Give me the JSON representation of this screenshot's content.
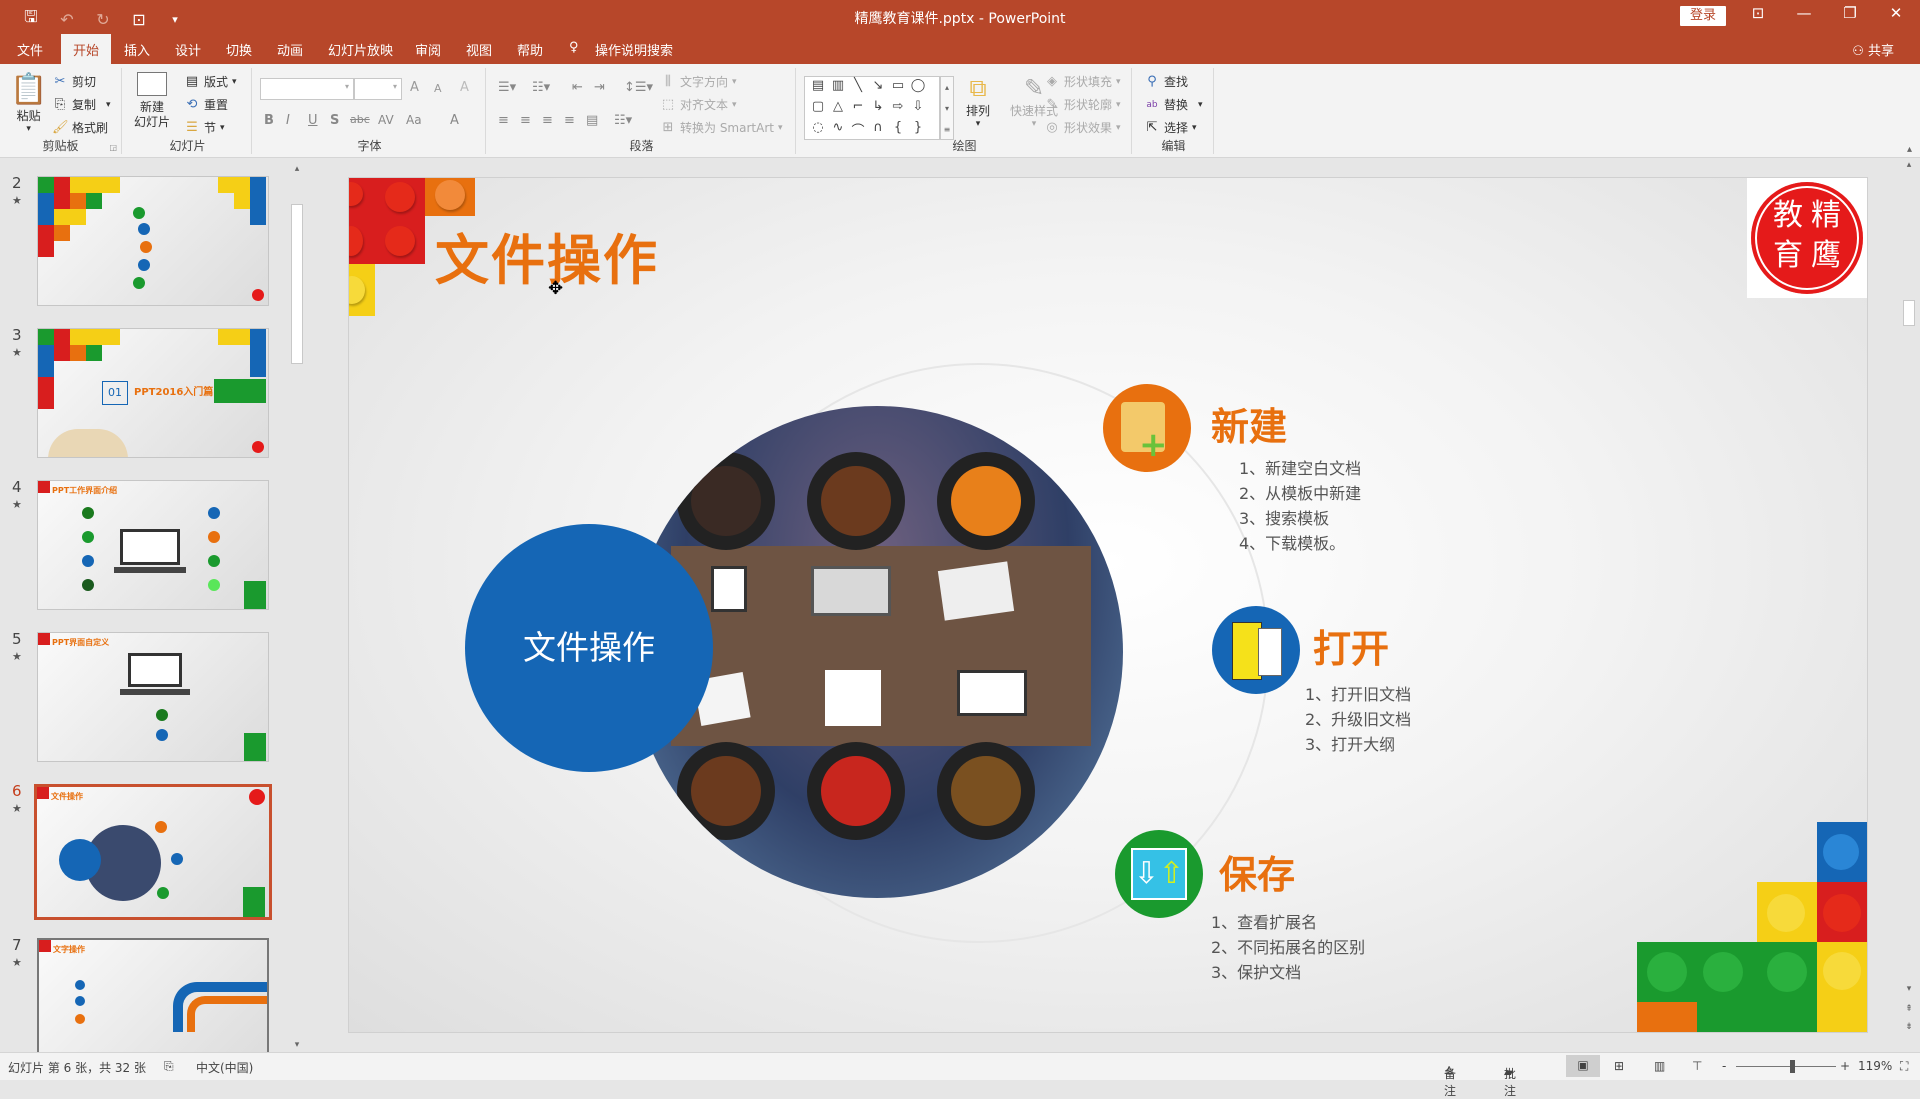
{
  "app": {
    "title": "精鹰教育课件.pptx  -  PowerPoint",
    "login_label": "登录",
    "share_label": "共享",
    "qat": [
      {
        "icon": "save-icon",
        "glyph": "🖫"
      },
      {
        "icon": "undo-icon",
        "glyph": "↶"
      },
      {
        "icon": "redo-icon",
        "glyph": "↻"
      },
      {
        "icon": "slideshow-from-start-icon",
        "glyph": "⊡"
      },
      {
        "icon": "customize-qat-icon",
        "glyph": "▾"
      }
    ],
    "window_controls": [
      {
        "name": "ribbon-display-options-button",
        "glyph": "⊡"
      },
      {
        "name": "minimize-button",
        "glyph": "—"
      },
      {
        "name": "restore-button",
        "glyph": "❐"
      },
      {
        "name": "close-button",
        "glyph": "✕"
      }
    ]
  },
  "tabs": [
    {
      "label": "文件"
    },
    {
      "label": "开始",
      "active": true
    },
    {
      "label": "插入"
    },
    {
      "label": "设计"
    },
    {
      "label": "切换"
    },
    {
      "label": "动画"
    },
    {
      "label": "幻灯片放映"
    },
    {
      "label": "审阅"
    },
    {
      "label": "视图"
    },
    {
      "label": "帮助"
    },
    {
      "label": "操作说明搜索",
      "icon": "lightbulb-icon"
    }
  ],
  "ribbon": {
    "clipboard": {
      "label": "剪贴板",
      "paste": "粘贴",
      "cut": "剪切",
      "copy": "复制",
      "format_painter": "格式刷"
    },
    "slides": {
      "label": "幻灯片",
      "new_slide_line1": "新建",
      "new_slide_line2": "幻灯片",
      "layout": "版式",
      "reset": "重置",
      "section": "节"
    },
    "font": {
      "label": "字体",
      "font_name": "",
      "font_size": "",
      "increase": "A",
      "decrease": "A",
      "clear": "A",
      "bold": "B",
      "italic": "I",
      "underline": "U",
      "shadow": "S",
      "strike": "abc",
      "spacing": "AV",
      "case": "Aa",
      "color": "A"
    },
    "paragraph": {
      "label": "段落",
      "text_direction": "文字方向",
      "align_text": "对齐文本",
      "smartart": "转换为 SmartArt"
    },
    "drawing": {
      "label": "绘图",
      "arrange": "排列",
      "quick_styles": "快速样式",
      "shape_fill": "形状填充",
      "shape_outline": "形状轮廓",
      "shape_effects": "形状效果",
      "shapes": [
        "▤",
        "▥",
        "╲",
        "↘",
        "▭",
        "◯",
        "▢",
        "△",
        "⌐",
        "↳",
        "⇨",
        "⇩",
        "◌",
        "∿",
        "⌒",
        "∩",
        "{",
        "}"
      ]
    },
    "editing": {
      "label": "编辑",
      "find": "查找",
      "replace": "替换",
      "select": "选择"
    }
  },
  "thumbnails": [
    {
      "num": "2",
      "title": ""
    },
    {
      "num": "3",
      "title": "PPT2016入门篇",
      "badge": "01"
    },
    {
      "num": "4",
      "title": "PPT工作界面介绍"
    },
    {
      "num": "5",
      "title": "PPT界面自定义"
    },
    {
      "num": "6",
      "title": "文件操作",
      "selected": true
    },
    {
      "num": "7",
      "title": "文字操作"
    }
  ],
  "slide": {
    "title": "文件操作",
    "center_label": "文件操作",
    "seal_chars": [
      "教",
      "精",
      "育",
      "鹰"
    ],
    "sections": [
      {
        "heading": "新建",
        "icon": "new-folder-icon",
        "color": "#e8700f",
        "items": [
          "1、新建空白文档",
          "2、从模板中新建",
          "3、搜索模板",
          "4、下载模板。"
        ]
      },
      {
        "heading": "打开",
        "icon": "open-folder-icon",
        "color": "#1566b5",
        "items": [
          "1、打开旧文档",
          "2、升级旧文档",
          "3、打开大纲"
        ]
      },
      {
        "heading": "保存",
        "icon": "save-folder-icon",
        "color": "#1a9a2e",
        "items": [
          "1、查看扩展名",
          "2、不同拓展名的区别",
          "3、保护文档"
        ]
      }
    ]
  },
  "status": {
    "slide_info": "幻灯片 第 6 张，共 32 张",
    "language": "中文(中国)",
    "notes": "备注",
    "comments": "批注",
    "zoom": "119%",
    "zoom_minus": "-",
    "zoom_plus": "+",
    "zoom_fraction": 0.56
  },
  "colors": {
    "accent": "#b7472a",
    "title_orange": "#e8700f",
    "brand_blue": "#1566b5"
  }
}
